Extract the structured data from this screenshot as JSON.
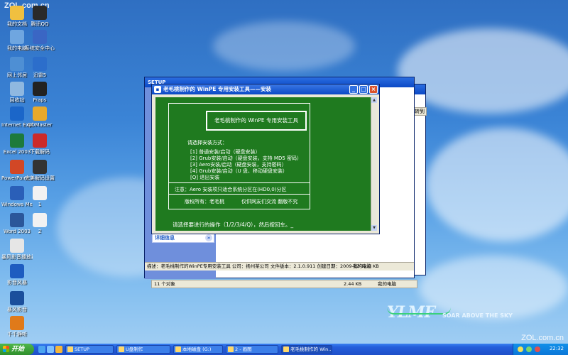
{
  "watermark": {
    "top": "ZOL.com.cn",
    "bottom": "ZOL.com.cn"
  },
  "desktop_icons": [
    {
      "label": "我的文档",
      "icon": "documents-icon",
      "color": "#f0c040"
    },
    {
      "label": "腾讯QQ",
      "icon": "qq-icon",
      "color": "#2a2a2a"
    },
    {
      "label": "我的电脑",
      "icon": "computer-icon",
      "color": "#6fa6e0"
    },
    {
      "label": "系统安全中心",
      "icon": "security-center-icon",
      "color": "#3a66c4"
    },
    {
      "label": "网上邻居",
      "icon": "network-icon",
      "color": "#4e8fd4"
    },
    {
      "label": "迅雷5",
      "icon": "thunder-icon",
      "color": "#2c6ecb"
    },
    {
      "label": "回收站",
      "icon": "recycle-bin-icon",
      "color": "#8fb8e0"
    },
    {
      "label": "Fraps",
      "icon": "fraps-icon",
      "color": "#222222"
    },
    {
      "label": "Internet Explorer",
      "icon": "ie-icon",
      "color": "#1b66c9"
    },
    {
      "label": "DDMaster",
      "icon": "ddmaster-icon",
      "color": "#e8a92c"
    },
    {
      "label": "Excel 2003",
      "icon": "excel-icon",
      "color": "#1d7a3c"
    },
    {
      "label": "下载解码",
      "icon": "download-icon",
      "color": "#cc2a2a"
    },
    {
      "label": "PowerPoint 2003",
      "icon": "powerpoint-icon",
      "color": "#d24726"
    },
    {
      "label": "完美解码设置",
      "icon": "codec-settings-icon",
      "color": "#333333"
    },
    {
      "label": "Windows Media Player",
      "icon": "media-player-icon",
      "color": "#2a5fb8"
    },
    {
      "label": "1",
      "icon": "file-icon",
      "color": "#f2f2f2"
    },
    {
      "label": "Word 2003",
      "icon": "word-icon",
      "color": "#2b579a"
    },
    {
      "label": "2",
      "icon": "file-icon",
      "color": "#f2f2f2"
    },
    {
      "label": "暴风影音播放器",
      "icon": "storm-player-icon",
      "color": "#e6e6e6"
    },
    {
      "label": "影音风暴",
      "icon": "storm-codec-icon",
      "color": "#1e5cc0"
    },
    {
      "label": "暴风影音",
      "icon": "storm-icon",
      "color": "#1b4f9c"
    },
    {
      "label": "千千静听",
      "icon": "ttplayer-icon",
      "color": "#e07a1a"
    }
  ],
  "explorer": {
    "title": "SETUP",
    "details_label": "详细信息",
    "status_text": "描述：老毛桃制作的WinPE专用安装工具 公司：扬州某公司 文件版本：2.1.0.911 创建日期：2009-12-12.0 KB",
    "status_location": "我的电脑",
    "status_objects": "11 个对象",
    "status_size": "2.44 KB",
    "status_pc": "我的电脑",
    "goto_label": "转到"
  },
  "setup_window": {
    "title": "老毛桃制作的 WinPE 专用安装工具——安装",
    "panel_title": "老毛桃制作的 WinPE 专用安装工具",
    "prompt_head": "请选择安装方式：",
    "options": [
      "[1] 普通安装/启动（硬盘安装）",
      "[2] Grub安装/启动（硬盘安装，支持 MD5 密码）",
      "[3] Aero安装/启动（硬盘安装，支持密码）",
      "[4] Grub安装/启动（U 盘、移动硬盘安装）",
      "[Q] 退出安装"
    ],
    "note": "注意：Aero 安装项只适合系统分区在(HD0,0)分区",
    "copyright": "版权所有：老毛桃",
    "copyright2": "仅供网友们交流  翻版不究",
    "input_prompt": "请选择要进行的操作（1/2/3/4/Q），然后按回车。_"
  },
  "brand": {
    "logo": "YLMF",
    "slogan": "SOAR ABOVE THE SKY"
  },
  "taskbar": {
    "start_label": "开始",
    "tasks": [
      {
        "label": "SETUP",
        "active": false
      },
      {
        "label": "U盘制作",
        "active": false
      },
      {
        "label": "本地磁盘 (G:)",
        "active": false
      },
      {
        "label": "2 - 画图",
        "active": false
      },
      {
        "label": "老毛桃制作的 Win...",
        "active": true
      }
    ],
    "clock": "22:32"
  },
  "colors": {
    "console_bg": "#1f7a1f",
    "titlebar": "#0b49c6",
    "taskbar": "#245edb",
    "start": "#2f8f2c"
  }
}
